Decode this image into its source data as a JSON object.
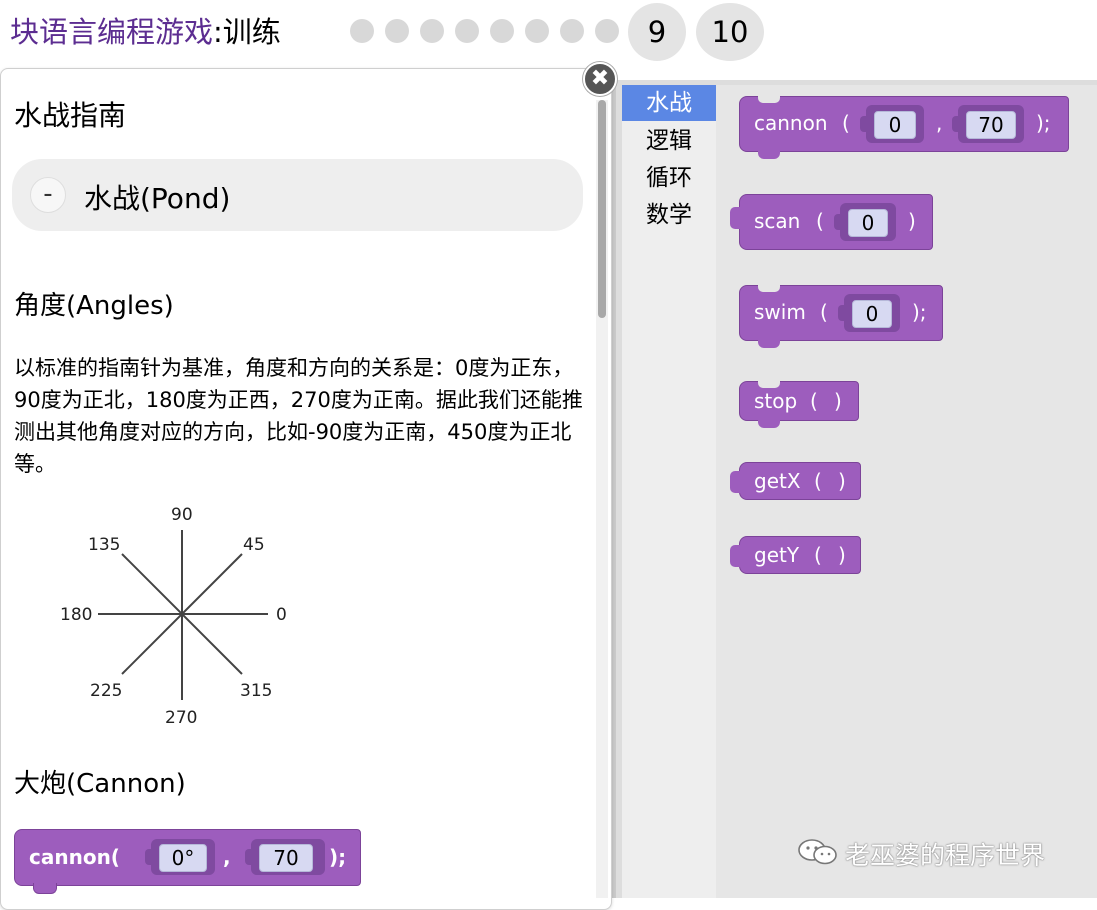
{
  "header": {
    "app_title": "块语言编程游戏",
    "separator": ":",
    "level_name": "训练",
    "level_dots_count": 8,
    "current_levels": [
      "9",
      "10"
    ]
  },
  "dialog": {
    "close_glyph": "✖",
    "guide_title": "水战指南",
    "accordion": {
      "toggle": "-",
      "label": "水战(Pond)"
    },
    "angles": {
      "heading": "角度(Angles)",
      "paragraph": "以标准的指南针为基准，角度和方向的关系是：0度为正东，90度为正北，180度为正西，270度为正南。据此我们还能推测出其他角度对应的方向，比如-90度为正南，450度为正北等。",
      "compass_labels": [
        "0",
        "45",
        "90",
        "135",
        "180",
        "225",
        "270",
        "315"
      ]
    },
    "cannon": {
      "heading": "大炮(Cannon)",
      "block": {
        "name": "cannon(",
        "arg1": "0°",
        "comma": ",",
        "arg2": "70",
        "end": ");"
      }
    }
  },
  "toolbox": {
    "categories": [
      {
        "label": "水战",
        "selected": true
      },
      {
        "label": "逻辑",
        "selected": false
      },
      {
        "label": "循环",
        "selected": false
      },
      {
        "label": "数学",
        "selected": false
      }
    ],
    "blocks": {
      "cannon": {
        "name": "cannon",
        "open": "(",
        "arg1": "0",
        "comma": ",",
        "arg2": "70",
        "end": ");"
      },
      "scan": {
        "name": "scan",
        "open": "(",
        "arg1": "0",
        "end": ")"
      },
      "swim": {
        "name": "swim",
        "open": "(",
        "arg1": "0",
        "end": ");"
      },
      "stop": {
        "name": "stop",
        "open": "(",
        "end": ")"
      },
      "getx": {
        "name": "getX",
        "open": "(",
        "end": ")"
      },
      "gety": {
        "name": "getY",
        "open": "(",
        "end": ")"
      }
    }
  },
  "watermark": {
    "text": "老巫婆的程序世界"
  },
  "colors": {
    "block_purple": "#9d5dbd",
    "title_purple": "#5c2d91",
    "category_selected": "#5b87e4"
  }
}
